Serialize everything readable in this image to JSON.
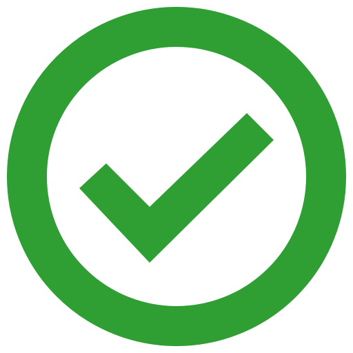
{
  "icon": {
    "name": "check-circle-icon",
    "color": "#2f9e33",
    "background": "#ffffff"
  }
}
